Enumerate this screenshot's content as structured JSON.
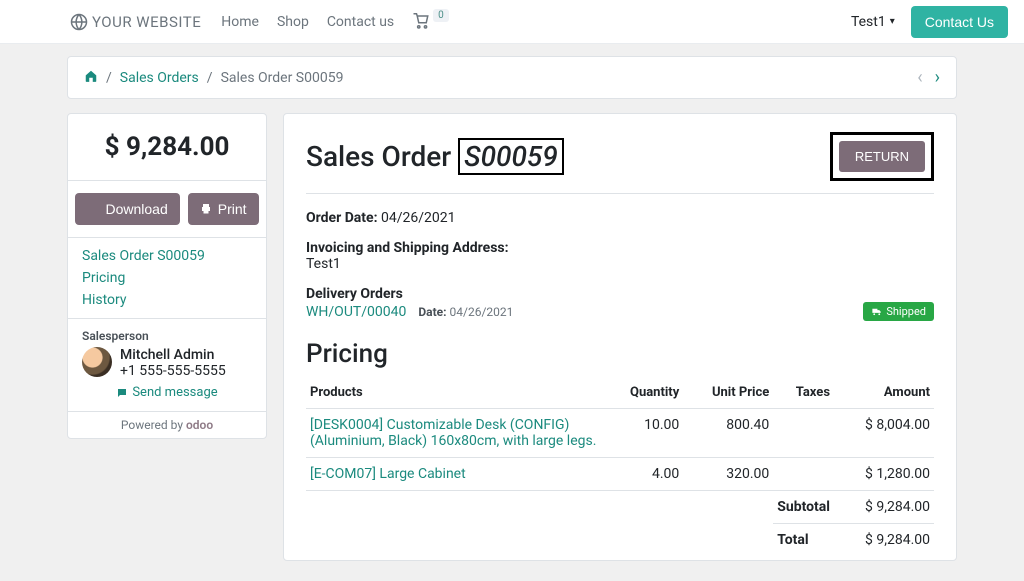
{
  "navbar": {
    "brand": "YOUR WEBSITE",
    "links": {
      "home": "Home",
      "shop": "Shop",
      "contact": "Contact us"
    },
    "cart_count": "0",
    "user": "Test1",
    "contact_btn": "Contact Us"
  },
  "breadcrumb": {
    "sales_orders": "Sales Orders",
    "current": "Sales Order S00059"
  },
  "sidebar": {
    "total": "$ 9,284.00",
    "download": "Download",
    "print": "Print",
    "links": {
      "order": "Sales Order S00059",
      "pricing": "Pricing",
      "history": "History"
    },
    "salesperson_label": "Salesperson",
    "salesperson_name": "Mitchell Admin",
    "salesperson_phone": "+1 555-555-5555",
    "send_message": "Send message",
    "powered_by": "Powered by"
  },
  "order": {
    "title_prefix": "Sales Order",
    "title_number": "S00059",
    "return_btn": "RETURN",
    "order_date_label": "Order Date:",
    "order_date": "04/26/2021",
    "address_label": "Invoicing and Shipping Address:",
    "address_value": "Test1",
    "delivery_label": "Delivery Orders",
    "delivery_ref": "WH/OUT/00040",
    "delivery_date_label": "Date:",
    "delivery_date": "04/26/2021",
    "shipped_badge": "Shipped"
  },
  "pricing": {
    "heading": "Pricing",
    "cols": {
      "products": "Products",
      "qty": "Quantity",
      "unit": "Unit Price",
      "taxes": "Taxes",
      "amount": "Amount"
    },
    "rows": [
      {
        "product": "[DESK0004] Customizable Desk (CONFIG) (Aluminium, Black) 160x80cm, with large legs.",
        "qty": "10.00",
        "unit": "800.40",
        "taxes": "",
        "amount": "$ 8,004.00"
      },
      {
        "product": "[E-COM07] Large Cabinet",
        "qty": "4.00",
        "unit": "320.00",
        "taxes": "",
        "amount": "$ 1,280.00"
      }
    ],
    "subtotal_label": "Subtotal",
    "subtotal": "$ 9,284.00",
    "total_label": "Total",
    "total": "$ 9,284.00"
  }
}
